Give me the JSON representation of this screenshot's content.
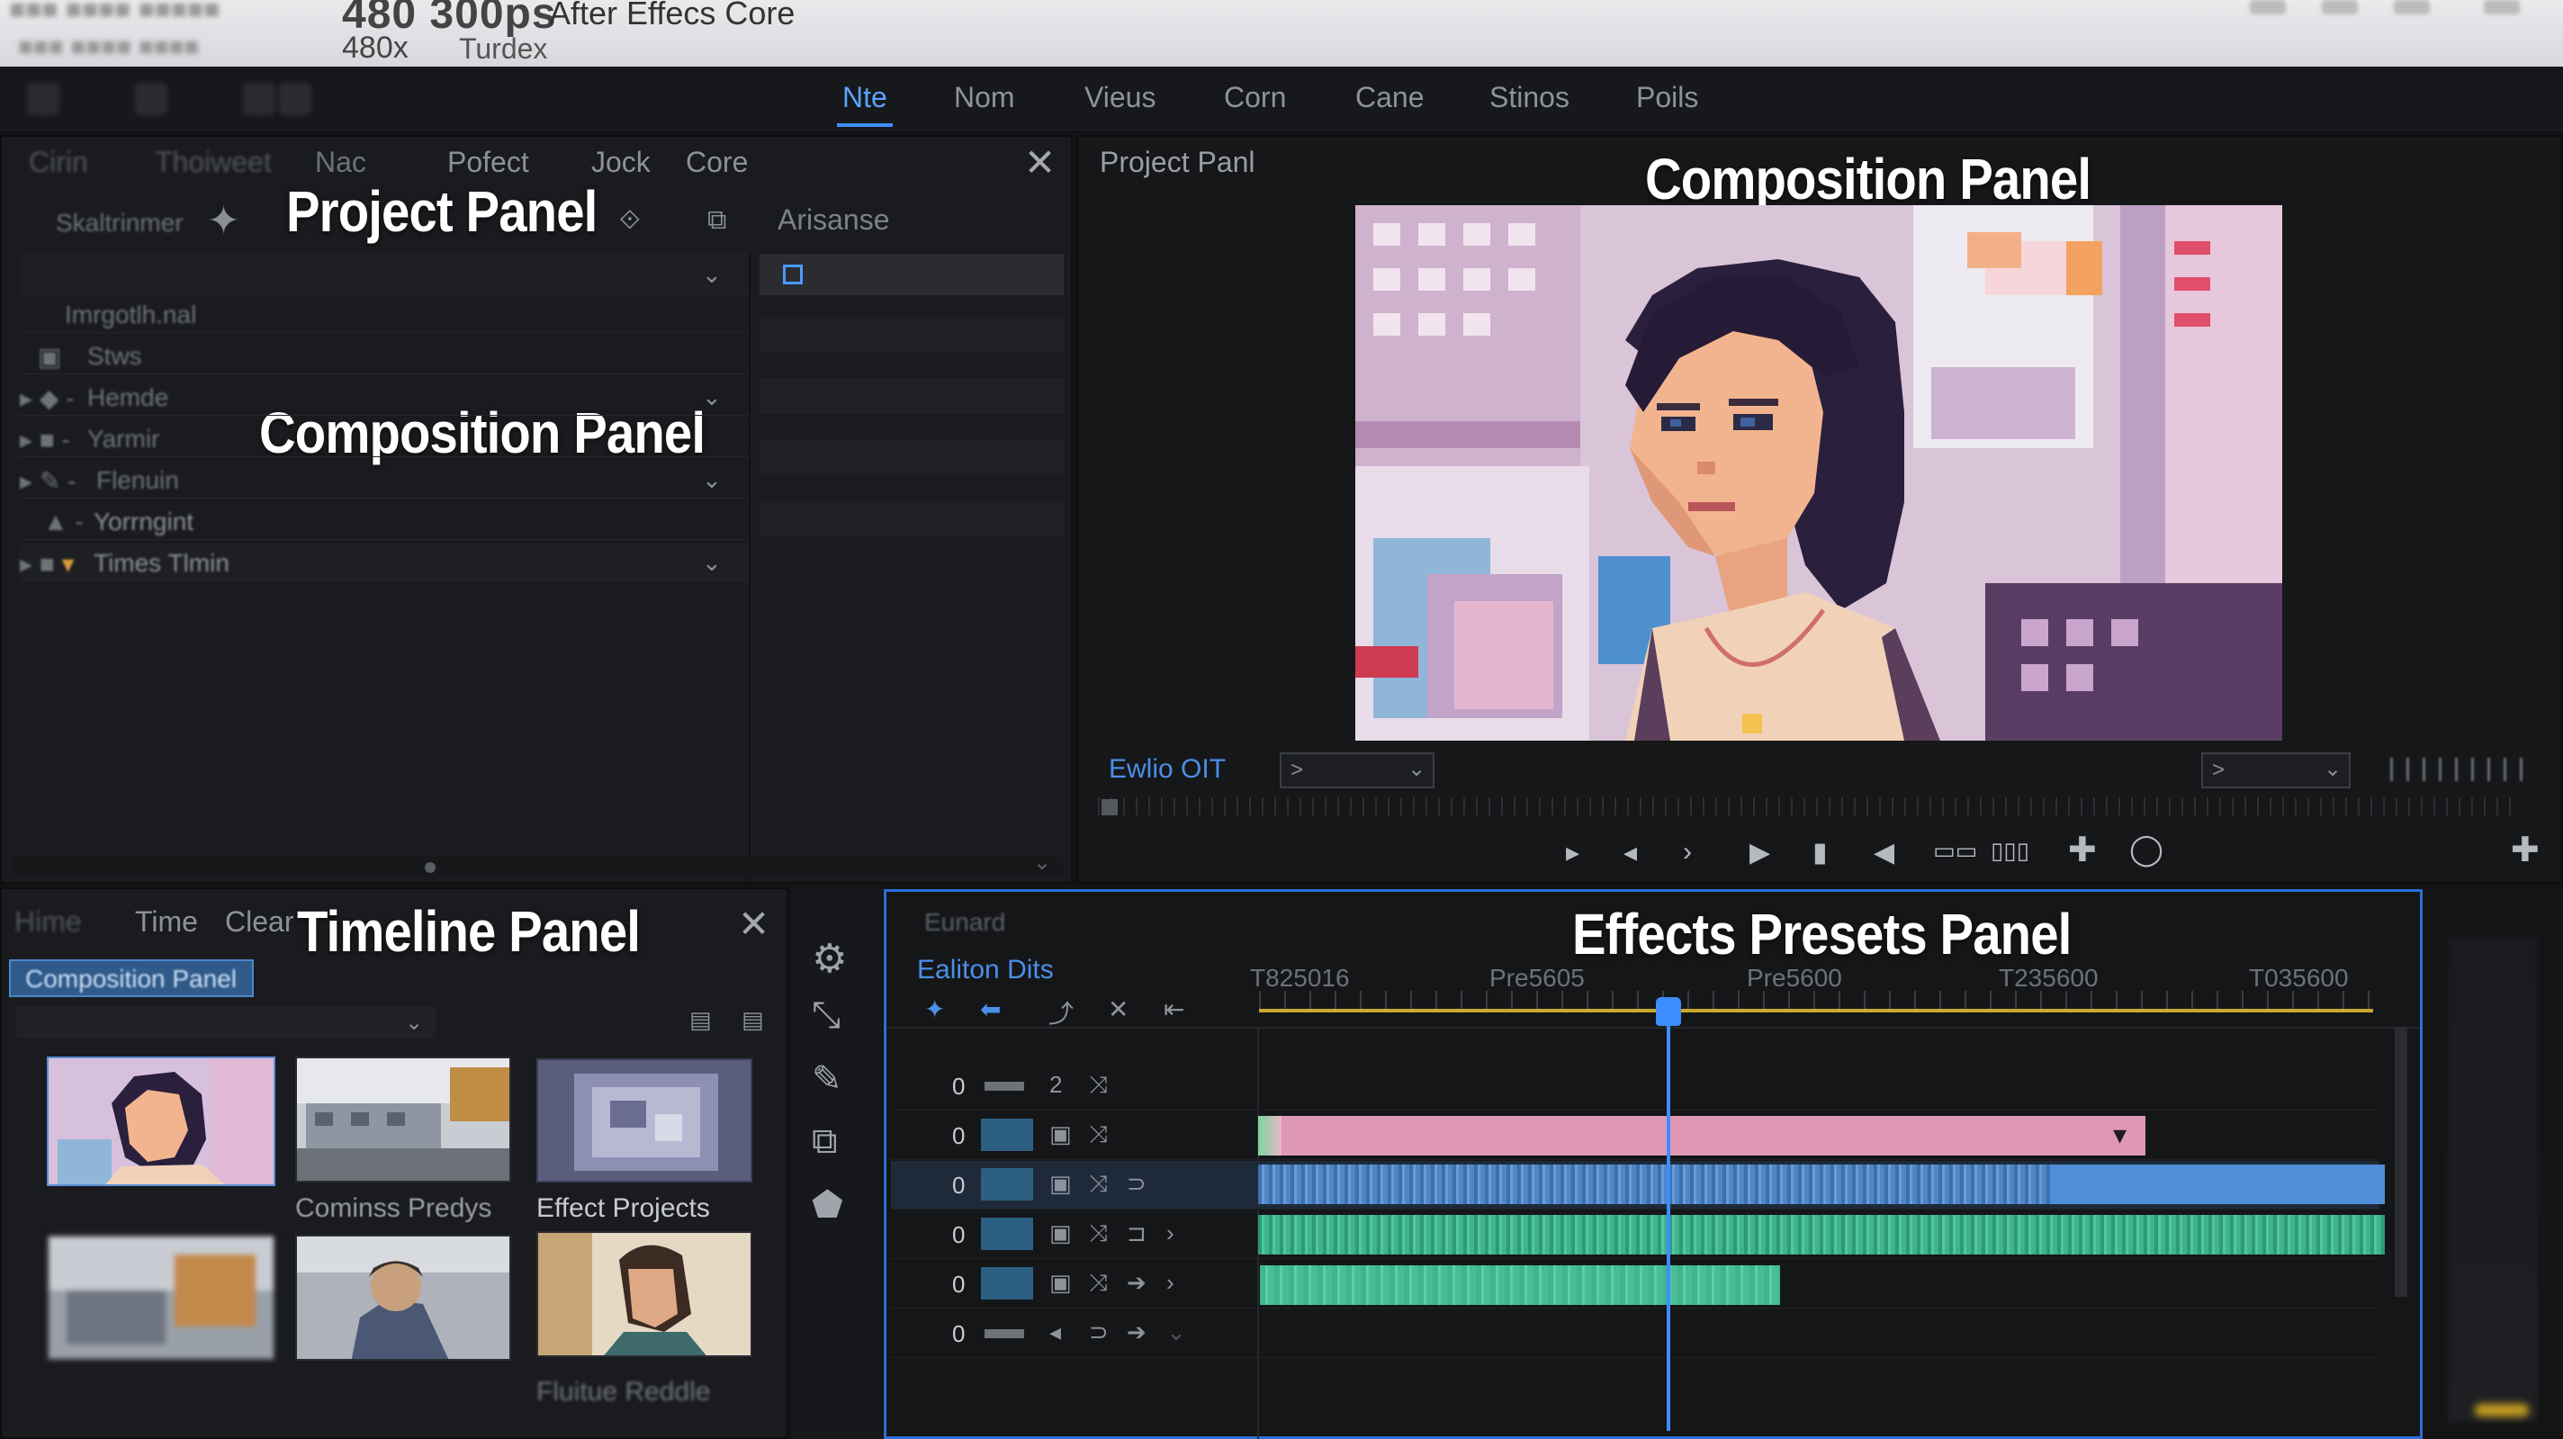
{
  "titlebar": {
    "fps": "480 300ps",
    "app": "After Effecs Core",
    "zoom": "480x",
    "doc": "Turdex"
  },
  "menu": {
    "items": [
      "Nte",
      "Nom",
      "Vieus",
      "Corn",
      "Cane",
      "Stinos",
      "Poils"
    ],
    "active": "Nte"
  },
  "project_panel": {
    "tabs": [
      "Nac",
      "Pofect",
      "Jock",
      "Core"
    ],
    "overlay": "Project Panel",
    "overlay2": "Composition Panel",
    "column": "Arisanse",
    "rows": [
      "Imrgotlh.nal",
      "Stws",
      "Hemde",
      "Yarmir",
      "Flenuin",
      "Yorrngint",
      "Times Tlmin"
    ]
  },
  "comp_panel": {
    "tab": "Project Panl",
    "overlay": "Composition Panel",
    "channel": "Ewlio OIT",
    "zoom_select": ">",
    "view_select": ">"
  },
  "timeline_panel": {
    "tabs": [
      "Time",
      "Clear"
    ],
    "tab_faded": "Hime",
    "overlay": "Timeline Panel",
    "active_comp": "Composition Panel",
    "thumbs": [
      "Cominss Predys",
      "Effect Projects",
      "Fluitue Reddle"
    ]
  },
  "effects_panel": {
    "overlay": "Effects Presets Panel",
    "header": "Eunard",
    "subheader": "Ealiton Dits",
    "ruler": [
      "T825016",
      "Pre5605",
      "Pre5600",
      "T235600",
      "T035600"
    ],
    "track_nums": [
      "0",
      "0",
      "0",
      "0",
      "0",
      "0"
    ]
  },
  "colors": {
    "accent": "#3d8dff",
    "pink_clip": "#de97b4",
    "audio_blue": "#4f86c6",
    "audio_green": "#3fb48f",
    "work_area": "#c9a830"
  }
}
